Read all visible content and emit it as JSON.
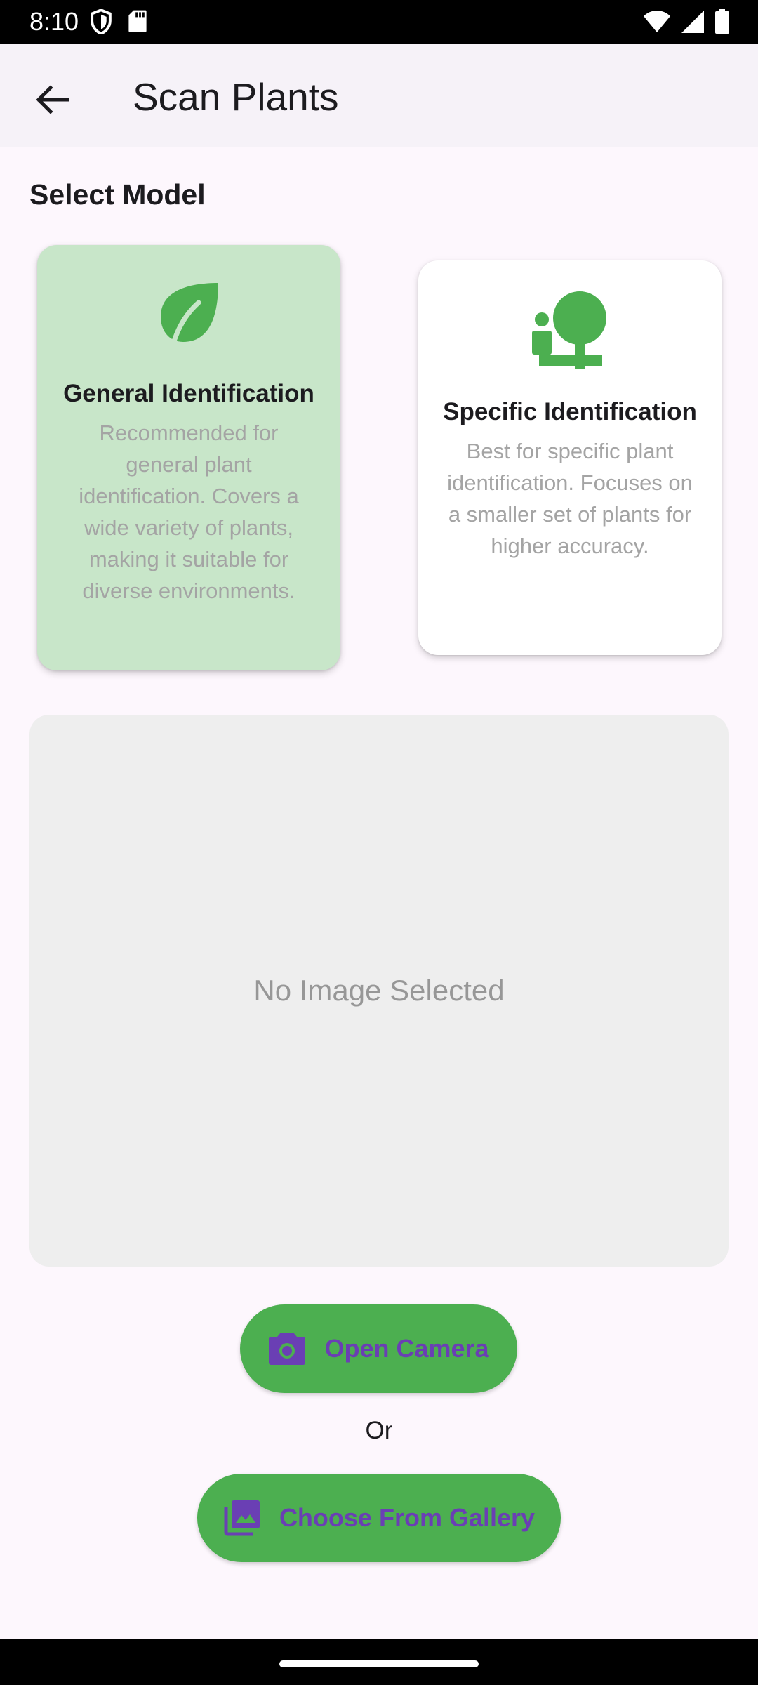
{
  "status_bar": {
    "time": "8:10",
    "icons_left": [
      "shield-icon",
      "sd-card-icon"
    ],
    "icons_right": [
      "wifi-icon",
      "cellular-signal-icon",
      "battery-icon"
    ]
  },
  "app_bar": {
    "back_icon": "arrow-back-icon",
    "title": "Scan Plants"
  },
  "model_section": {
    "title": "Select Model",
    "selected": "general",
    "cards": [
      {
        "id": "general",
        "icon": "leaf-icon",
        "title": "General Identification",
        "description": "Recommended for general plant identification. Covers a wide variety of plants, making it suitable for diverse environments.",
        "background": "#c8e6c9"
      },
      {
        "id": "specific",
        "icon": "person-tree-icon",
        "title": "Specific Identification",
        "description": "Best for specific plant identification. Focuses on a smaller set of plants for higher accuracy.",
        "background": "#ffffff"
      }
    ]
  },
  "image_preview": {
    "placeholder": "No Image Selected"
  },
  "actions": {
    "camera_label": "Open Camera",
    "camera_icon": "camera-icon",
    "separator": "Or",
    "gallery_label": "Choose From Gallery",
    "gallery_icon": "photo-library-icon"
  },
  "colors": {
    "accent_green": "#4caf50",
    "button_text": "#6a3fb4",
    "selected_card": "#c8e6c9",
    "background": "#fdf7fd"
  }
}
